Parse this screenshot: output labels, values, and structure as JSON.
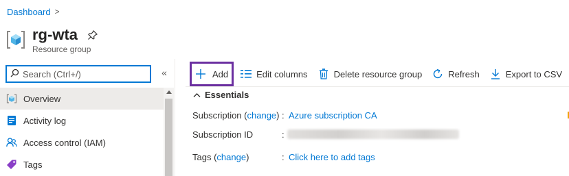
{
  "breadcrumb": {
    "home": "Dashboard",
    "separator": ">"
  },
  "header": {
    "title": "rg-wta",
    "subtitle": "Resource group",
    "icon": "resource-group-icon",
    "pin_icon": "pin-icon"
  },
  "search": {
    "placeholder": "Search (Ctrl+/)",
    "value": ""
  },
  "collapse_label": "«",
  "nav": {
    "items": [
      {
        "label": "Overview",
        "icon": "resource-group-icon",
        "active": true
      },
      {
        "label": "Activity log",
        "icon": "activity-log-icon",
        "active": false
      },
      {
        "label": "Access control (IAM)",
        "icon": "people-icon",
        "active": false
      },
      {
        "label": "Tags",
        "icon": "tag-icon",
        "active": false
      }
    ]
  },
  "toolbar": {
    "add": "Add",
    "edit_columns": "Edit columns",
    "delete": "Delete resource group",
    "refresh": "Refresh",
    "export": "Export to CSV"
  },
  "essentials": {
    "title": "Essentials",
    "subscription": {
      "label": "Subscription",
      "change": "change",
      "value": "Azure subscription CA"
    },
    "subscription_id": {
      "label": "Subscription ID"
    },
    "tags": {
      "label": "Tags",
      "change": "change",
      "value": "Click here to add tags"
    }
  },
  "colors": {
    "accent": "#0078d4",
    "highlight_border": "#6b2fa0",
    "selected_bg": "#edebe9"
  }
}
